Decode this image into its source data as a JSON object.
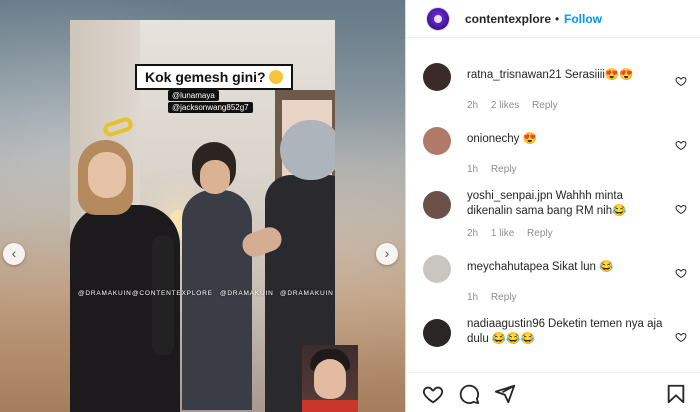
{
  "post": {
    "caption": "Kok gemesh gini?",
    "tags": [
      "@lunamaya",
      "@jacksonwang852g7"
    ],
    "watermarks": [
      "@DRAMAKUIN",
      "@CONTENTEXPLORE",
      "@DRAMAKUIN",
      "@DRAMAKUIN"
    ]
  },
  "carousel": {
    "prev_label": "‹",
    "next_label": "›"
  },
  "header": {
    "username": "contentexplore",
    "separator": "•",
    "follow_label": "Follow"
  },
  "comments": [
    {
      "username": "ratna_trisnawan21",
      "text": "Serasiiii😍😍",
      "time": "2h",
      "likes": "2 likes",
      "reply": "Reply",
      "avatar_color": "#3a2a2a"
    },
    {
      "username": "onionechy",
      "text": "😍",
      "time": "1h",
      "likes": "",
      "reply": "Reply",
      "avatar_color": "#b07a6a"
    },
    {
      "username": "yoshi_senpai.jpn",
      "text": "Wahhh minta dikenalin sama bang RM nih😂",
      "time": "2h",
      "likes": "1 like",
      "reply": "Reply",
      "avatar_color": "#6a5048"
    },
    {
      "username": "meychahutapea",
      "text": "Sikat lun 😂",
      "time": "1h",
      "likes": "",
      "reply": "Reply",
      "avatar_color": "#c9c6c2"
    },
    {
      "username": "nadiaagustin96",
      "text": "Deketin temen nya aja dulu 😂😂😂",
      "time": "",
      "likes": "",
      "reply": "",
      "avatar_color": "#2a2626"
    }
  ],
  "colors": {
    "accent": "#0095f6",
    "text": "#262626",
    "muted": "#8e8e8e"
  },
  "icons": [
    "heart-icon",
    "comment-icon",
    "share-icon",
    "bookmark-icon"
  ]
}
